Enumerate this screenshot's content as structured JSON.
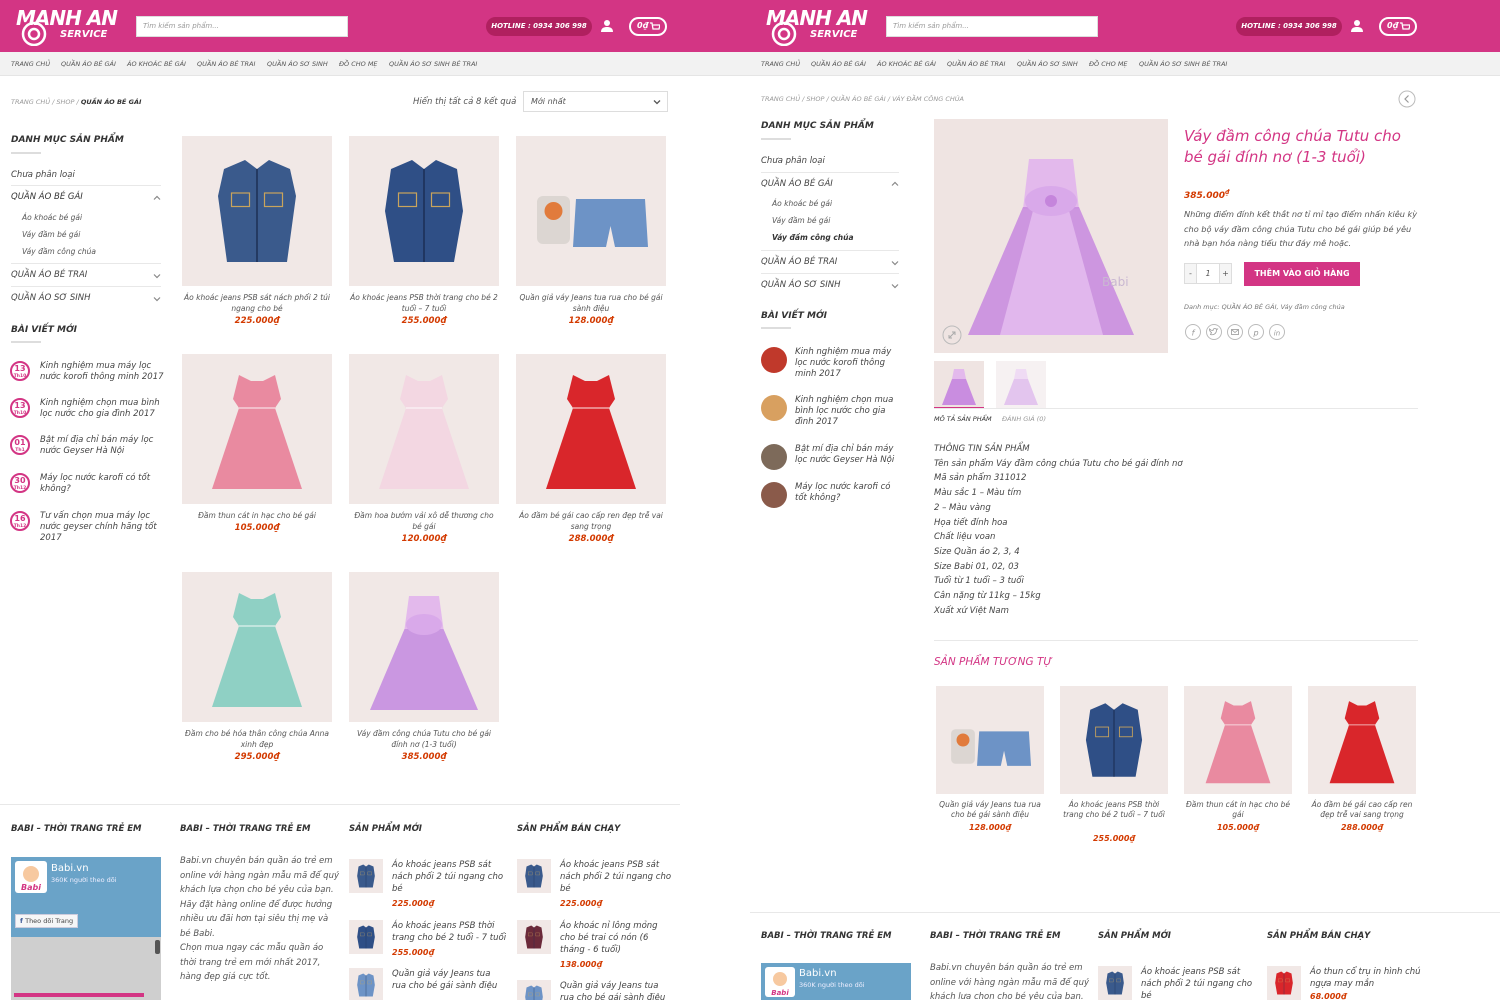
{
  "brand": {
    "name_line1": "MANH AN",
    "name_line2": "SERVICE",
    "accent": "#d33584"
  },
  "header": {
    "search_placeholder": "Tìm kiếm sản phẩm...",
    "hotline": "HOTLINE : 0934 306 998",
    "cart_total": "0₫",
    "icons": {
      "user": "user-icon",
      "cart": "cart-icon"
    }
  },
  "nav": [
    "TRANG CHỦ",
    "QUẦN ÁO BÉ GÁI",
    "ÁO KHOÁC BÉ GÁI",
    "QUẦN ÁO BÉ TRAI",
    "QUẦN ÁO SƠ SINH",
    "ĐỒ CHO MẸ",
    "QUẦN ÁO SƠ SINH BÉ TRAI"
  ],
  "left": {
    "breadcrumb": [
      "TRANG CHỦ",
      "SHOP",
      "QUẦN ÁO BÉ GÁI"
    ],
    "result_count": "Hiển thị tất cả 8 kết quả",
    "sort_selected": "Mới nhất",
    "sidebar": {
      "cat_title": "DANH MỤC SẢN PHẨM",
      "categories": [
        {
          "label": "Chưa phân loại"
        },
        {
          "label": "QUẦN ÁO BÉ GÁI",
          "children": [
            "Áo khoác bé gái",
            "Váy đầm bé gái",
            "Váy đầm công chúa"
          ]
        },
        {
          "label": "QUẦN ÁO BÉ TRAI"
        },
        {
          "label": "QUẦN ÁO SƠ SINH"
        }
      ],
      "posts_title": "BÀI VIẾT MỚI",
      "posts": [
        {
          "day": "13",
          "month": "Th10",
          "title": "Kinh nghiệm mua máy lọc nước korofi thông minh 2017"
        },
        {
          "day": "13",
          "month": "Th10",
          "title": "Kinh nghiệm chọn mua bình lọc nước cho gia đình 2017"
        },
        {
          "day": "01",
          "month": "Th1",
          "title": "Bật mí địa chỉ bán máy lọc nước Geyser Hà Nội"
        },
        {
          "day": "30",
          "month": "Th12",
          "title": "Máy lọc nước karofi có tốt không?"
        },
        {
          "day": "16",
          "month": "Th12",
          "title": "Tư vấn chọn mua máy lọc nước geyser chính hãng tốt 2017"
        }
      ]
    },
    "products": [
      {
        "name": "Áo khoác jeans PSB sát nách phối 2 túi ngang cho bé",
        "price": "225.000₫",
        "kind": "vest",
        "color": "#3a5a8c"
      },
      {
        "name": "Áo khoác jeans PSB thời trang cho bé 2 tuổi – 7 tuổi",
        "price": "255.000₫",
        "kind": "jacket",
        "color": "#2f4f86"
      },
      {
        "name": "Quần giả váy Jeans tua rua cho bé gái sành điệu",
        "price": "128.000₫",
        "kind": "shorts",
        "color": "#6d93c6"
      },
      {
        "name": "Đầm thun cát in hạc cho bé gái",
        "price": "105.000₫",
        "kind": "dress",
        "color": "#e98aa0"
      },
      {
        "name": "Đầm hoa bướm vải xô dễ thương cho bé gái",
        "price": "120.000₫",
        "kind": "dress",
        "color": "#f3d7e2"
      },
      {
        "name": "Áo đầm bé gái cao cấp ren đẹp trễ vai sang trọng",
        "price": "288.000₫",
        "kind": "dress",
        "color": "#d9262b"
      },
      {
        "name": "Đầm cho bé hóa thân công chúa Anna xinh đẹp",
        "price": "295.000₫",
        "kind": "dress",
        "color": "#8fd0c4"
      },
      {
        "name": "Váy đầm công chúa Tutu cho bé gái đính nơ (1-3 tuổi)",
        "price": "385.000₫",
        "kind": "tutu",
        "color": "#c58ee0"
      }
    ],
    "footer": {
      "col1_title": "BABI – THỜI TRANG TRẺ EM",
      "col2_title": "BABI – THỜI TRANG TRẺ EM",
      "col3_title": "SẢN PHẨM MỚI",
      "col4_title": "SẢN PHẨM BÁN CHẠY",
      "fb_name": "Babi.vn",
      "fb_likes": "360K người theo dõi",
      "fb_follow": "Theo dõi Trang",
      "about_lines": [
        "Babi.vn chuyên bán quần áo trẻ em",
        "online với hàng ngàn mẫu mã để quý",
        "khách lựa chọn cho bé yêu của bạn.",
        "Hãy đặt hàng online để được hưởng",
        "nhiều ưu đãi hơn tại siêu thị mẹ và",
        "bé Babi.",
        "Chọn mua ngay các mẫu quần áo",
        "thời trang trẻ em mới nhất 2017,",
        "hàng đẹp giá cực tốt."
      ],
      "new_products": [
        {
          "name": "Áo khoác jeans PSB sát nách phối 2 túi ngang cho bé",
          "price": "225.000₫",
          "color": "#3a5a8c"
        },
        {
          "name": "Áo khoác jeans PSB thời trang cho bé 2 tuổi - 7 tuổi",
          "price": "255.000₫",
          "color": "#2f4f86"
        },
        {
          "name": "Quần giả váy Jeans tua rua cho bé gái sành điệu",
          "price": "",
          "color": "#6d93c6"
        }
      ],
      "best_products": [
        {
          "name": "Áo khoác jeans PSB sát nách phối 2 túi ngang cho bé",
          "price": "225.000₫",
          "color": "#3a5a8c"
        },
        {
          "name": "Áo khoác nỉ lông mỏng cho bé trai có nón (6 tháng - 6 tuổi)",
          "price": "138.000₫",
          "color": "#6b2a3a"
        },
        {
          "name": "Quần giả váy Jeans tua rua cho bé gái sành điệu",
          "price": "",
          "color": "#6d93c6"
        }
      ]
    }
  },
  "right": {
    "breadcrumb": [
      "TRANG CHỦ",
      "SHOP",
      "QUẦN ÁO BÉ GÁI",
      "VÁY ĐẦM CÔNG CHÚA"
    ],
    "sidebar": {
      "cat_title": "DANH MỤC SẢN PHẨM",
      "categories": [
        {
          "label": "Chưa phân loại"
        },
        {
          "label": "QUẦN ÁO BÉ GÁI",
          "children": [
            "Áo khoác bé gái",
            "Váy đầm bé gái",
            "Váy đầm công chúa"
          ]
        },
        {
          "label": "QUẦN ÁO BÉ TRAI"
        },
        {
          "label": "QUẦN ÁO SƠ SINH"
        }
      ],
      "posts_title": "BÀI VIẾT MỚI",
      "posts": [
        {
          "title": "Kinh nghiệm mua máy lọc nước korofi thông minh 2017"
        },
        {
          "title": "Kinh nghiệm chọn mua bình lọc nước cho gia đình 2017"
        },
        {
          "title": "Bật mí địa chỉ bán máy lọc nước Geyser Hà Nội"
        },
        {
          "title": "Máy lọc nước karofi có tốt không?"
        }
      ]
    },
    "product": {
      "title": "Váy đầm công chúa Tutu cho bé gái đính nơ (1-3 tuổi)",
      "price": "385.000",
      "currency": "₫",
      "short_desc": [
        "Những điểm đính kết thắt nơ tỉ mỉ tạo điểm nhấn kiêu kỳ",
        "cho bộ váy đầm công chúa Tutu cho bé gái giúp bé yêu",
        "nhà bạn hóa nàng tiểu thư đáy mê hoặc."
      ],
      "qty": "1",
      "qty_minus": "-",
      "qty_plus": "+",
      "add_to_cart": "THÊM VÀO GIỎ HÀNG",
      "category_line": "Danh mục: QUẦN ÁO BÉ GÁI, Váy đầm công chúa",
      "watermark": "Babi",
      "share_icons": [
        "facebook-icon",
        "twitter-icon",
        "email-icon",
        "pinterest-icon",
        "linkedin-icon"
      ]
    },
    "tabs": [
      "MÔ TẢ SẢN PHẨM",
      "ĐÁNH GIÁ (0)"
    ],
    "specs": [
      "THÔNG TIN SẢN PHẨM",
      "Tên sản phẩm Váy đầm công chúa Tutu cho bé gái đính nơ",
      "Mã sản phẩm 311012",
      "Màu sắc 1 – Màu tím",
      "2 – Màu vàng",
      "Họa tiết đính hoa",
      "Chất liệu voan",
      "Size Quần áo 2, 3, 4",
      "Size Babi 01, 02, 03",
      "Tuổi từ 1 tuổi – 3 tuổi",
      "Cân nặng từ 11kg – 15kg",
      "Xuất xứ Việt Nam"
    ],
    "related_title": "SẢN PHẨM TƯƠNG TỰ",
    "related": [
      {
        "name": "Quần giả váy Jeans tua rua cho bé gái sành điệu",
        "price": "128.000₫",
        "color": "#6d93c6",
        "kind": "shorts"
      },
      {
        "name": "Áo khoác jeans PSB thời trang cho bé 2 tuổi – 7 tuổi",
        "price": "255.000₫",
        "color": "#2f4f86",
        "kind": "jacket"
      },
      {
        "name": "Đầm thun cát in hạc cho bé gái",
        "price": "105.000₫",
        "color": "#e98aa0",
        "kind": "dress"
      },
      {
        "name": "Áo đầm bé gái cao cấp ren đẹp trễ vai sang trọng",
        "price": "288.000₫",
        "color": "#d9262b",
        "kind": "dress"
      }
    ],
    "footer": {
      "col1_title": "BABI – THỜI TRANG TRẺ EM",
      "col2_title": "BABI – THỜI TRANG TRẺ EM",
      "col3_title": "SẢN PHẨM MỚI",
      "col4_title": "SẢN PHẨM BÁN CHẠY",
      "fb_name": "Babi.vn",
      "fb_likes": "360K người theo dõi",
      "about_lines": [
        "Babi.vn chuyên bán quần áo trẻ em",
        "online với hàng ngàn mẫu mã để quý",
        "khách lựa chọn cho bé yêu của bạn."
      ],
      "new_product": {
        "name": "Áo khoác jeans PSB sát nách phối 2 túi ngang cho bé",
        "color": "#3a5a8c"
      },
      "best_product": {
        "name": "Áo thun cổ trụ in hình chú ngựa may mắn",
        "price": "68.000₫",
        "color": "#d9262b"
      }
    }
  }
}
